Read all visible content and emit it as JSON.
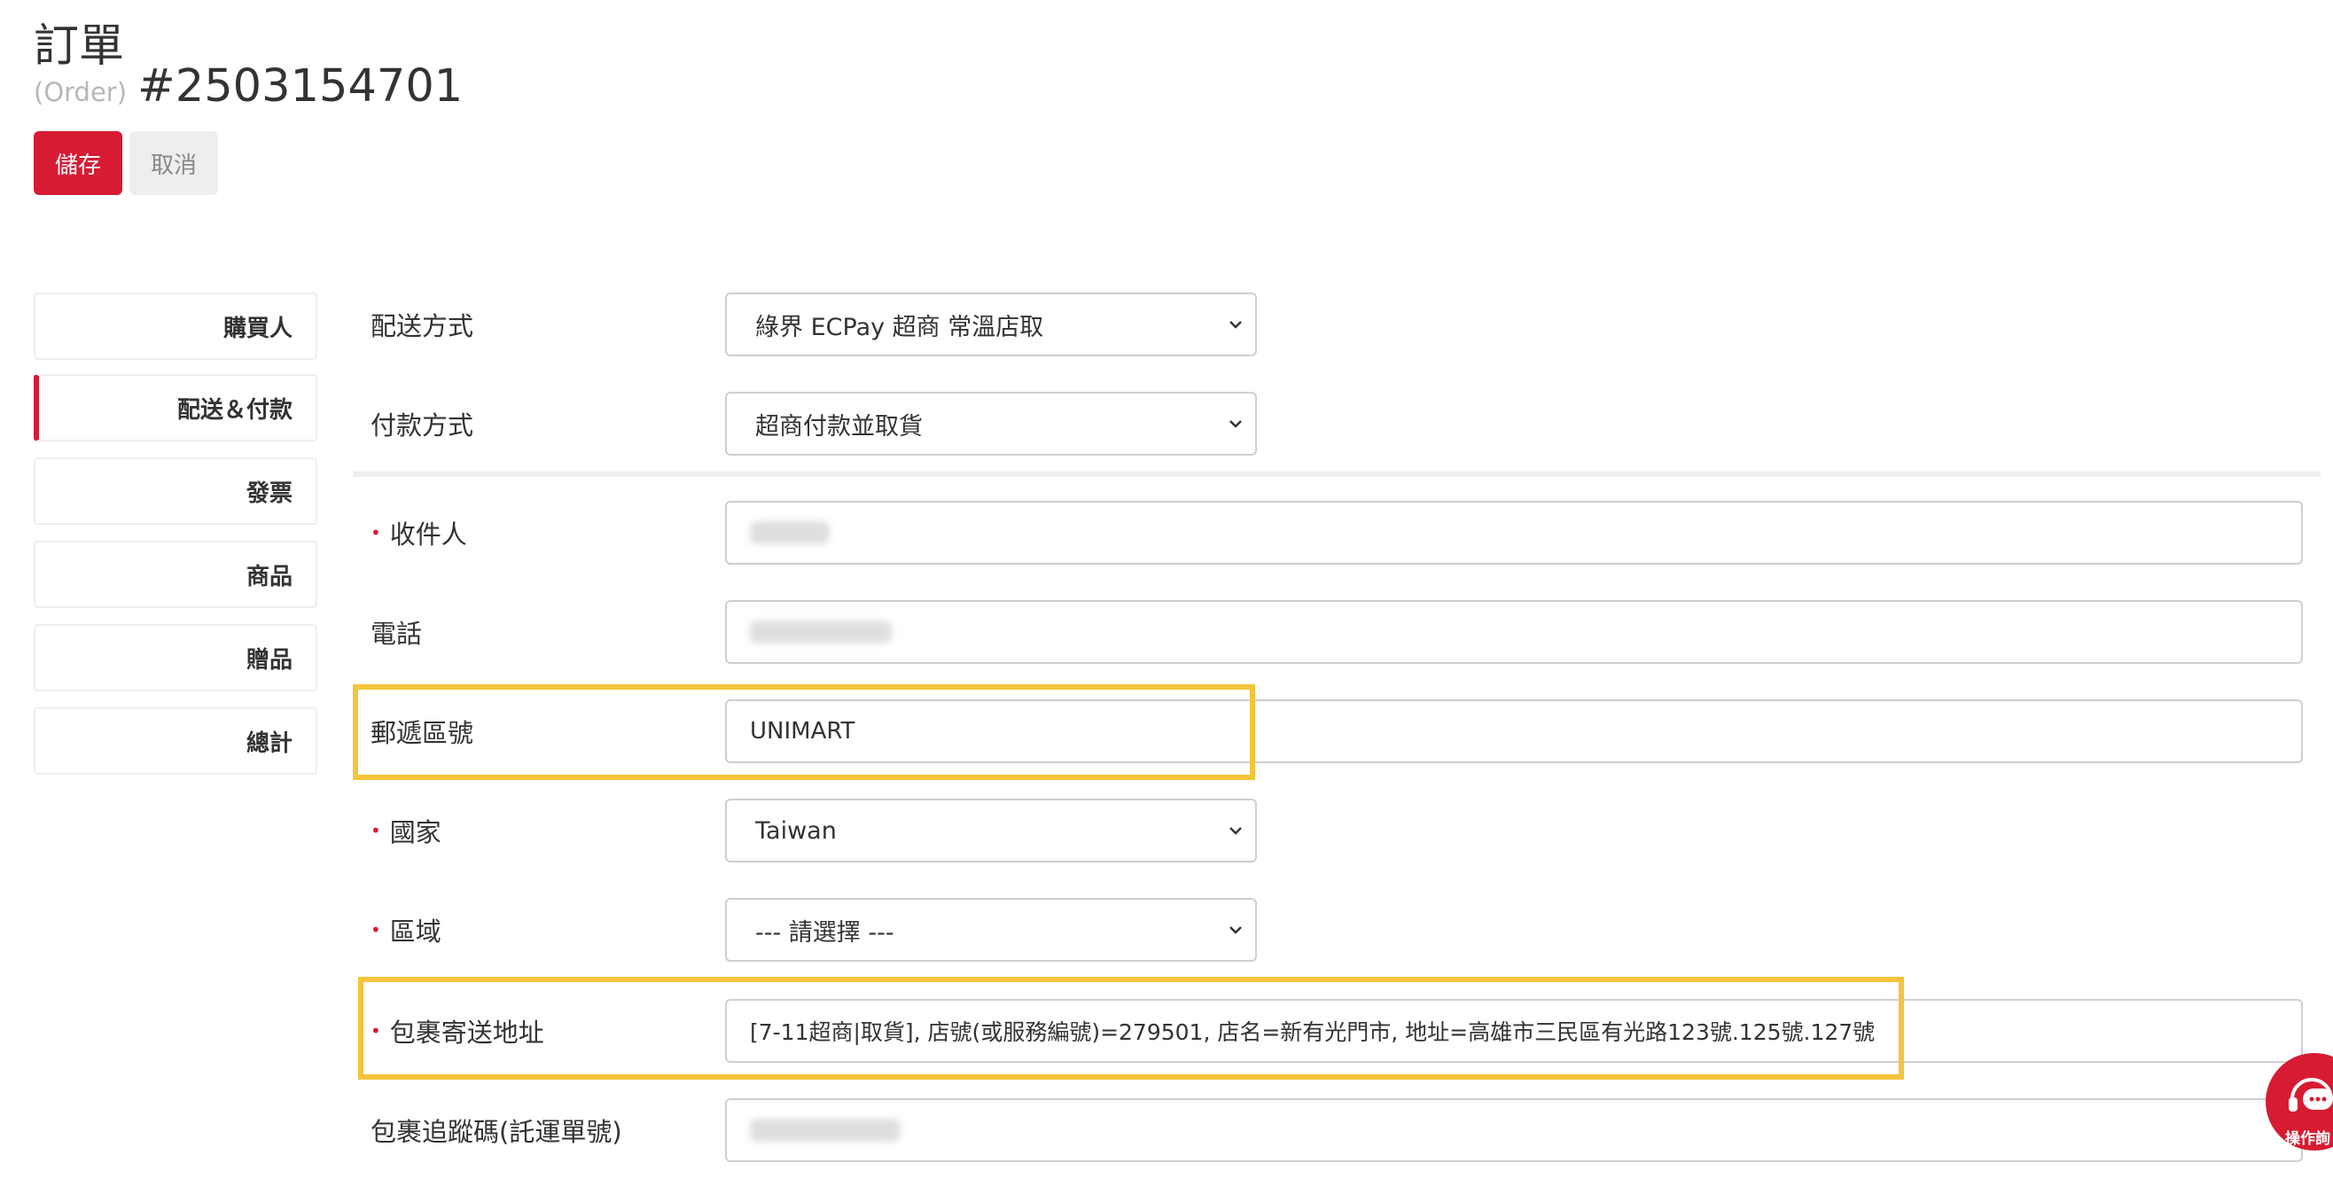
{
  "page": {
    "title": "訂單",
    "subtitle_en": "(Order)",
    "order_number": "#2503154701"
  },
  "actions": {
    "save_label": "儲存",
    "cancel_label": "取消"
  },
  "sidebar": {
    "items": [
      {
        "label": "購買人"
      },
      {
        "label": "配送＆付款",
        "active": true
      },
      {
        "label": "發票"
      },
      {
        "label": "商品"
      },
      {
        "label": "贈品"
      },
      {
        "label": "總計"
      }
    ]
  },
  "form": {
    "shipping_method": {
      "label": "配送方式",
      "value": "綠界 ECPay 超商 常溫店取"
    },
    "payment_method": {
      "label": "付款方式",
      "value": "超商付款並取貨"
    },
    "recipient": {
      "label": "收件人",
      "value": ""
    },
    "phone": {
      "label": "電話",
      "value": ""
    },
    "postal_code": {
      "label": "郵遞區號",
      "value": "UNIMART"
    },
    "country": {
      "label": "國家",
      "value": "Taiwan"
    },
    "region": {
      "label": "區域",
      "value": "--- 請選擇 ---"
    },
    "shipping_address": {
      "label": "包裹寄送地址",
      "value": "[7-11超商|取貨], 店號(或服務編號)=279501, 店名=新有光門市, 地址=高雄市三民區有光路123號.125號.127號"
    },
    "tracking_number": {
      "label": "包裹追蹤碼(託運單號)",
      "value": ""
    }
  },
  "chat_widget": {
    "label": "操作詢"
  },
  "colors": {
    "primary": "#d71b33",
    "highlight": "#f4c43a",
    "border": "#cfcfcf"
  }
}
